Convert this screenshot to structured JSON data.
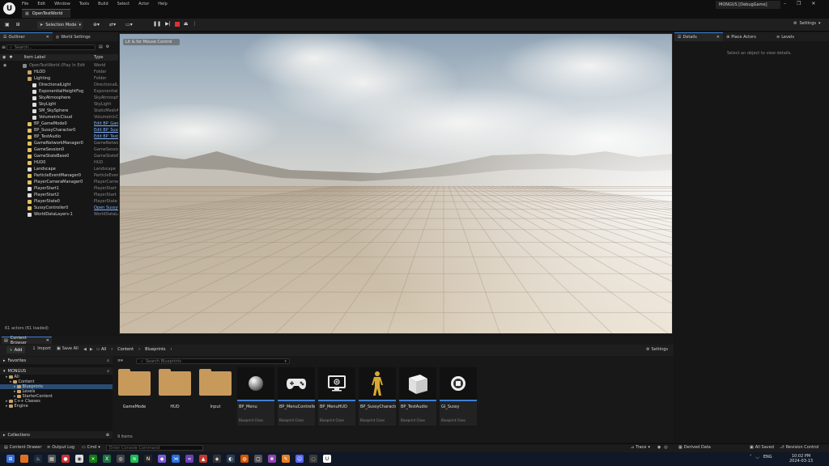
{
  "menu": [
    "File",
    "Edit",
    "Window",
    "Tools",
    "Build",
    "Select",
    "Actor",
    "Help"
  ],
  "document_tab": "OpenTestWorld",
  "project_title": "MONGUS [DebugGame]",
  "toolbar": {
    "selection_mode": "Selection Mode",
    "settings_label": "Settings"
  },
  "outliner": {
    "tabs": [
      "Outliner",
      "World Settings"
    ],
    "search_placeholder": "Search...",
    "col_label": "Item Label",
    "col_type": "Type",
    "rows": [
      {
        "name": "OpenTestWorld (Play In Edit",
        "type": "World",
        "indent": 1,
        "link": false,
        "color": "#888"
      },
      {
        "name": "HLOD",
        "type": "Folder",
        "indent": 2,
        "link": false,
        "color": "#c8a26b"
      },
      {
        "name": "Lighting",
        "type": "Folder",
        "indent": 2,
        "link": false,
        "color": "#c8a26b"
      },
      {
        "name": "DirectionalLight",
        "type": "DirectionalLi",
        "indent": 3,
        "link": false,
        "color": "#ddd"
      },
      {
        "name": "ExponentialHeightFog",
        "type": "Exponentiali",
        "indent": 3,
        "link": false,
        "color": "#ddd"
      },
      {
        "name": "SkyAtmosphere",
        "type": "SkyAtmosphe",
        "indent": 3,
        "link": false,
        "color": "#ddd"
      },
      {
        "name": "SkyLight",
        "type": "SkyLight",
        "indent": 3,
        "link": false,
        "color": "#ddd"
      },
      {
        "name": "SM_SkySphere",
        "type": "StaticMeshA",
        "indent": 3,
        "link": false,
        "color": "#ddd"
      },
      {
        "name": "VolumetricCloud",
        "type": "VolumetricCl",
        "indent": 3,
        "link": false,
        "color": "#ddd"
      },
      {
        "name": "BP_GameMode0",
        "type": "Edit BP_Gam",
        "indent": 2,
        "link": true,
        "color": "#e0c060"
      },
      {
        "name": "BP_SussyCharacter0",
        "type": "Edit BP_Suss",
        "indent": 2,
        "link": true,
        "color": "#e0c060"
      },
      {
        "name": "BP_TestAudio",
        "type": "Edit BP_Test",
        "indent": 2,
        "link": true,
        "color": "#e0c060"
      },
      {
        "name": "GameNetworkManager0",
        "type": "GameNetwork",
        "indent": 2,
        "link": false,
        "color": "#e0c060"
      },
      {
        "name": "GameSession0",
        "type": "GameSession",
        "indent": 2,
        "link": false,
        "color": "#e0c060"
      },
      {
        "name": "GameStateBase0",
        "type": "GameStateBa",
        "indent": 2,
        "link": false,
        "color": "#e0c060"
      },
      {
        "name": "HUD0",
        "type": "HUD",
        "indent": 2,
        "link": false,
        "color": "#e0c060"
      },
      {
        "name": "Landscape",
        "type": "Landscape",
        "indent": 2,
        "link": false,
        "color": "#ddd"
      },
      {
        "name": "ParticleEventManager0",
        "type": "ParticleEvent",
        "indent": 2,
        "link": false,
        "color": "#e0c060"
      },
      {
        "name": "PlayerCameraManager0",
        "type": "PlayerCamer",
        "indent": 2,
        "link": false,
        "color": "#e0c060"
      },
      {
        "name": "PlayerStart1",
        "type": "PlayerStart",
        "indent": 2,
        "link": false,
        "color": "#ddd"
      },
      {
        "name": "PlayerStart2",
        "type": "PlayerStart",
        "indent": 2,
        "link": false,
        "color": "#ddd"
      },
      {
        "name": "PlayerState0",
        "type": "PlayerState",
        "indent": 2,
        "link": false,
        "color": "#e0c060"
      },
      {
        "name": "SussyController0",
        "type": "Open Sussyt",
        "indent": 2,
        "link": true,
        "color": "#e0c060"
      },
      {
        "name": "WorldDataLayers-1",
        "type": "WorldDataLa",
        "indent": 2,
        "link": false,
        "color": "#ddd"
      }
    ],
    "actor_count": "61 actors (61 loaded)"
  },
  "viewport": {
    "tag": "Lit & for Mouse Control"
  },
  "details": {
    "tabs": [
      "Details",
      "Place Actors",
      "Levels"
    ],
    "hint": "Select an object to view details."
  },
  "content_browser": {
    "tab": "Content Browser",
    "add": "Add",
    "import": "Import",
    "save_all": "Save All",
    "breadcrumbs": [
      "All",
      "Content",
      "Blueprints"
    ],
    "settings": "Settings",
    "search_placeholder": "Search Blueprints",
    "favorites": "Favorites",
    "project": "MONGUS",
    "collections": "Collections",
    "tree": [
      {
        "name": "All",
        "indent": 1,
        "selected": false
      },
      {
        "name": "Content",
        "indent": 2,
        "selected": false
      },
      {
        "name": "Blueprints",
        "indent": 3,
        "selected": true
      },
      {
        "name": "Levels",
        "indent": 3,
        "selected": false
      },
      {
        "name": "StarterContent",
        "indent": 3,
        "selected": false
      },
      {
        "name": "C++ Classes",
        "indent": 1,
        "selected": false
      },
      {
        "name": "Engine",
        "indent": 1,
        "selected": false
      }
    ],
    "items": [
      {
        "name": "GameMode",
        "kind": "folder",
        "cls": "",
        "icon": ""
      },
      {
        "name": "HUD",
        "kind": "folder",
        "cls": "",
        "icon": ""
      },
      {
        "name": "Input",
        "kind": "folder",
        "cls": "",
        "icon": ""
      },
      {
        "name": "BP_Menu",
        "kind": "asset",
        "cls": "Blueprint Class",
        "icon": "sphere-icon"
      },
      {
        "name": "BP_MenuController",
        "kind": "asset",
        "cls": "Blueprint Class",
        "icon": "gamepad-icon"
      },
      {
        "name": "BP_MenuHUD",
        "kind": "asset",
        "cls": "Blueprint Class",
        "icon": "monitor-icon"
      },
      {
        "name": "BP_SussyCharacter",
        "kind": "asset",
        "cls": "Blueprint Class",
        "icon": "mannequin-icon"
      },
      {
        "name": "BP_TestAudio",
        "kind": "asset",
        "cls": "Blueprint Class",
        "icon": "cube-icon"
      },
      {
        "name": "GI_Sussy",
        "kind": "asset",
        "cls": "Blueprint Class",
        "icon": "game-instance-icon"
      }
    ],
    "item_count": "9 items"
  },
  "statusbar": {
    "content_drawer": "Content Drawer",
    "output_log": "Output Log",
    "cmd": "Cmd",
    "console_placeholder": "Enter Console Command",
    "trace": "Trace",
    "derived_data": "Derived Data",
    "all_saved": "All Saved",
    "revision_control": "Revision Control"
  },
  "taskbar": {
    "lang": "ENG",
    "time": "10:02 PM",
    "date": "2024-03-13"
  },
  "colors": {
    "accent": "#3d7fd6",
    "folder": "#c79a5c",
    "stop": "#d33333"
  }
}
